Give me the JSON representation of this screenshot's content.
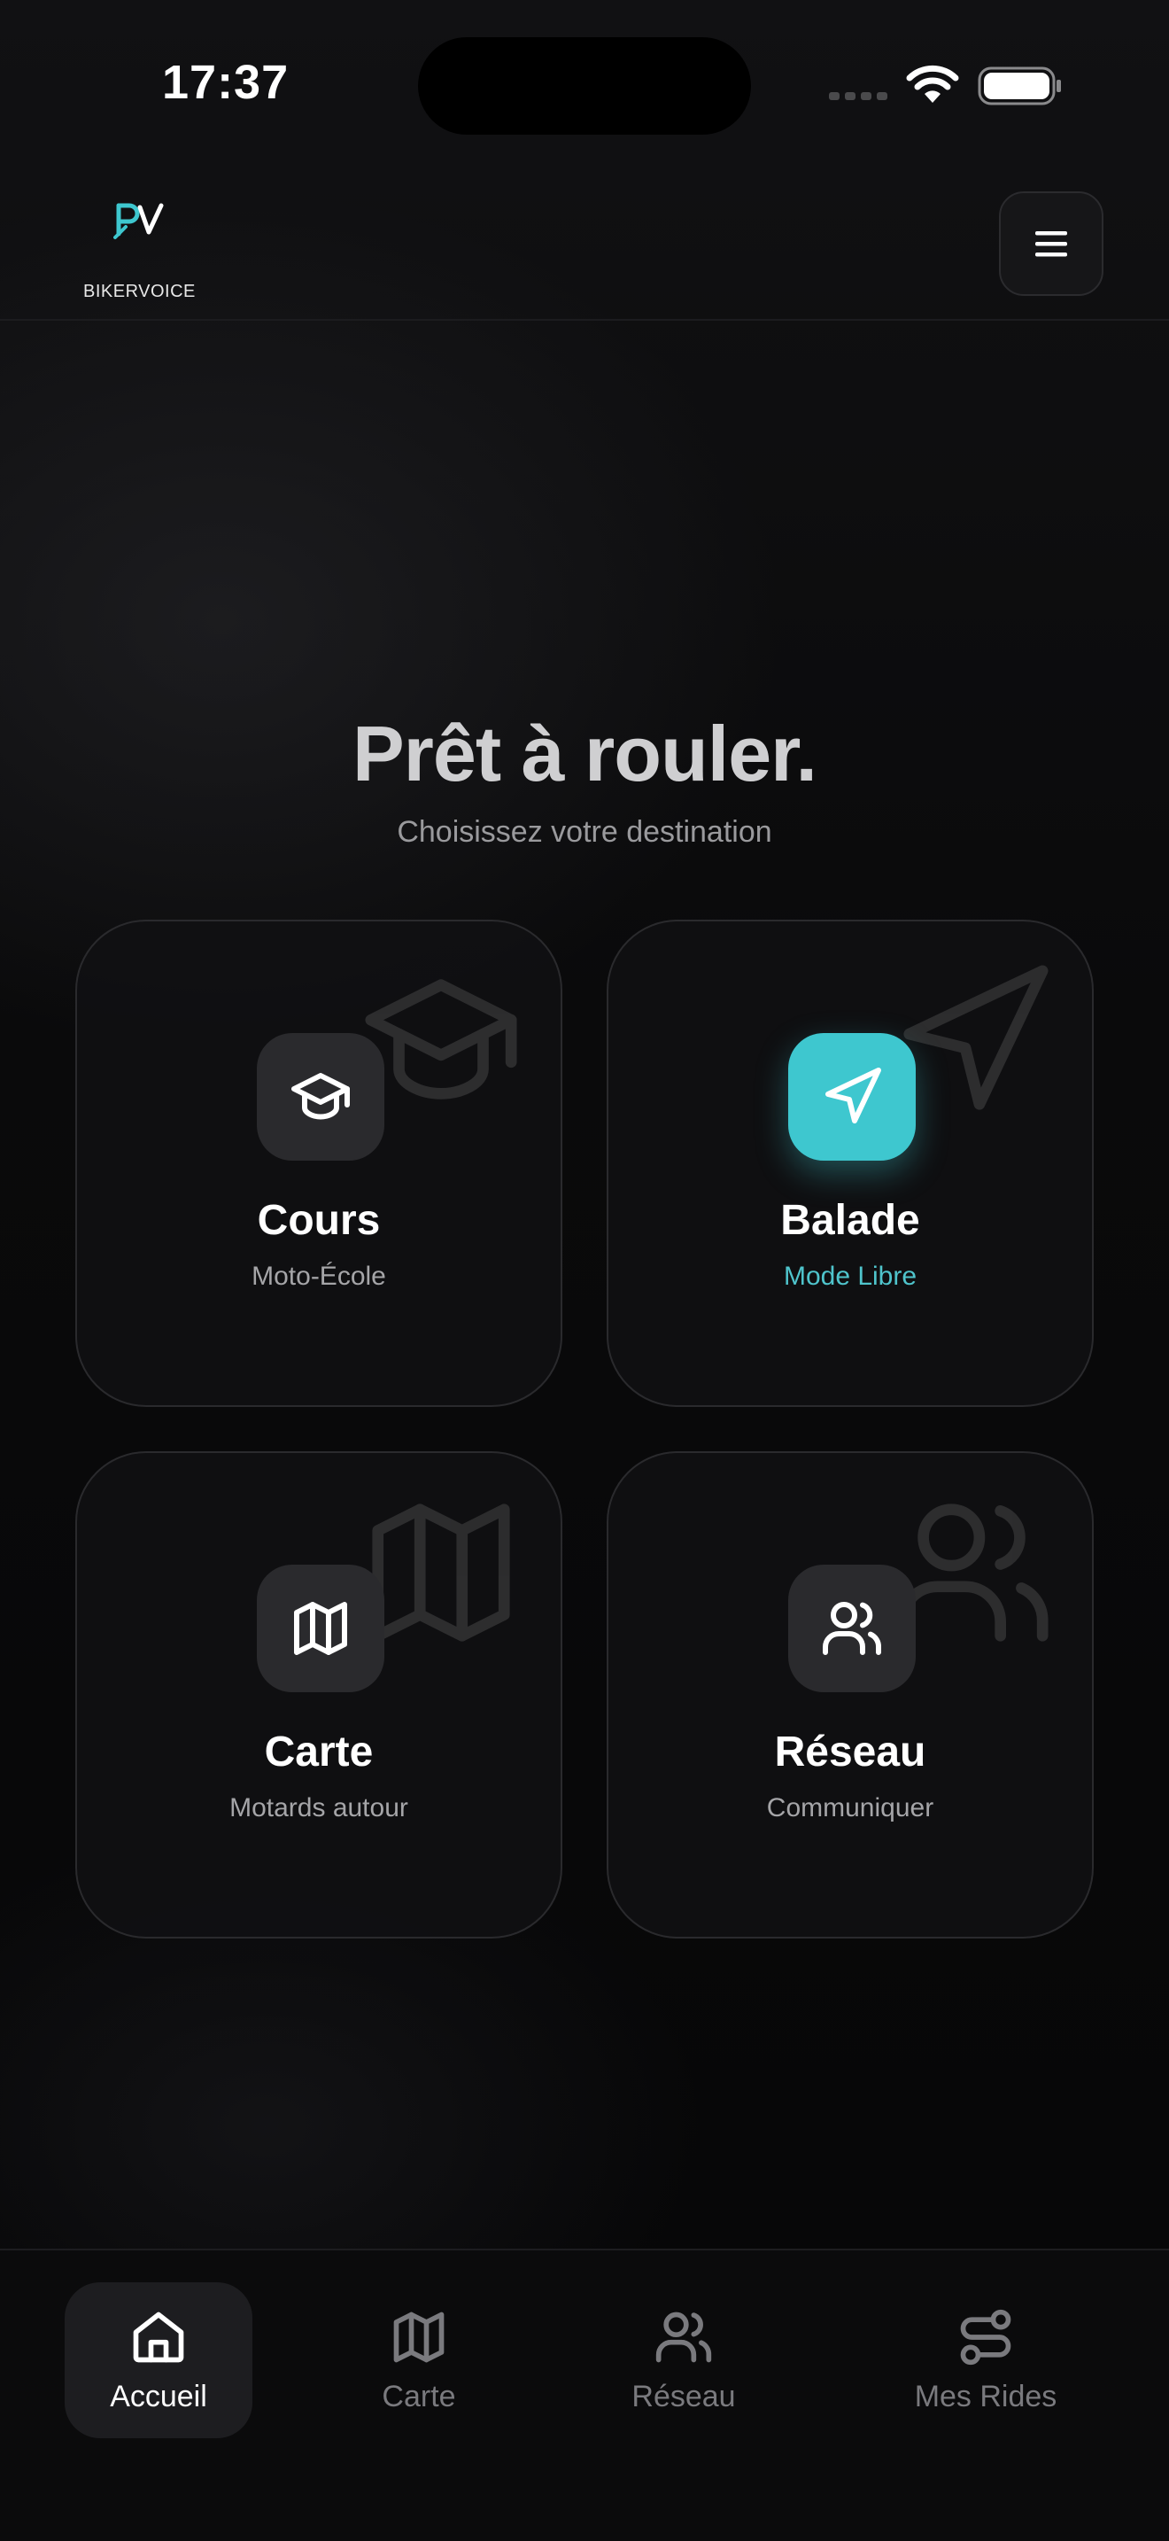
{
  "status_bar": {
    "time": "17:37"
  },
  "header": {
    "logo_text": "BIKERVOICE",
    "menu_icon": "hamburger-menu-icon"
  },
  "hero": {
    "title": "Prêt à rouler.",
    "subtitle": "Choisissez votre destination"
  },
  "cards": [
    {
      "title": "Cours",
      "subtitle": "Moto-École",
      "icon": "graduation-cap-icon"
    },
    {
      "title": "Balade",
      "subtitle": "Mode Libre",
      "icon": "navigation-arrow-icon"
    },
    {
      "title": "Carte",
      "subtitle": "Motards autour",
      "icon": "map-icon"
    },
    {
      "title": "Réseau",
      "subtitle": "Communiquer",
      "icon": "users-icon"
    }
  ],
  "bottom_nav": {
    "items": [
      {
        "label": "Accueil",
        "icon": "home-icon",
        "active": true
      },
      {
        "label": "Carte",
        "icon": "map-icon",
        "active": false
      },
      {
        "label": "Réseau",
        "icon": "users-icon",
        "active": false
      },
      {
        "label": "Mes Rides",
        "icon": "route-icon",
        "active": false
      }
    ]
  },
  "colors": {
    "accent": "#3ec7cf",
    "background": "#060607",
    "card": "#101012",
    "text_muted": "#9a9a9d"
  }
}
